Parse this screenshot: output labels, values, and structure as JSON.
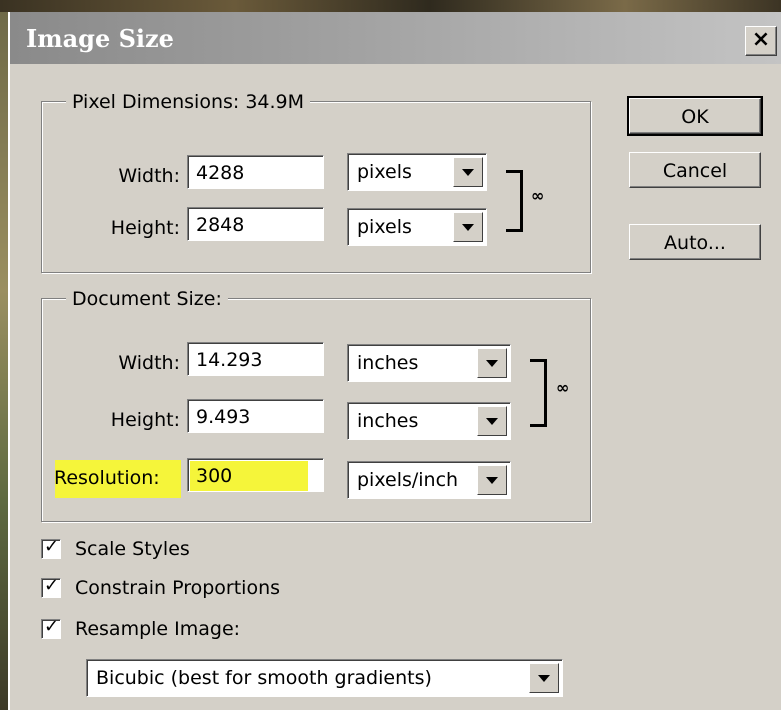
{
  "dialog": {
    "title": "Image Size",
    "close_glyph": "×"
  },
  "pixel_dimensions": {
    "legend": "Pixel Dimensions:  34.9M",
    "width": {
      "label": "Width:",
      "value": "4288",
      "unit": "pixels"
    },
    "height": {
      "label": "Height:",
      "value": "2848",
      "unit": "pixels"
    }
  },
  "document_size": {
    "legend": "Document Size:",
    "width": {
      "label": "Width:",
      "value": "14.293",
      "unit": "inches"
    },
    "height": {
      "label": "Height:",
      "value": "9.493",
      "unit": "inches"
    },
    "resolution": {
      "label": "Resolution:",
      "value": "300",
      "unit": "pixels/inch",
      "highlight_color": "#f5f53a"
    }
  },
  "buttons": {
    "ok": "OK",
    "cancel": "Cancel",
    "auto": "Auto..."
  },
  "options": {
    "scale_styles": {
      "label": "Scale Styles",
      "checked": true
    },
    "constrain_proportions": {
      "label": "Constrain Proportions",
      "checked": true
    },
    "resample_image": {
      "label": "Resample Image:",
      "checked": true
    },
    "resample_method": "Bicubic (best for smooth gradients)"
  },
  "icons": {
    "link": "chain-link-icon",
    "dropdown": "chevron-down-icon",
    "check": "checkmark-icon"
  }
}
